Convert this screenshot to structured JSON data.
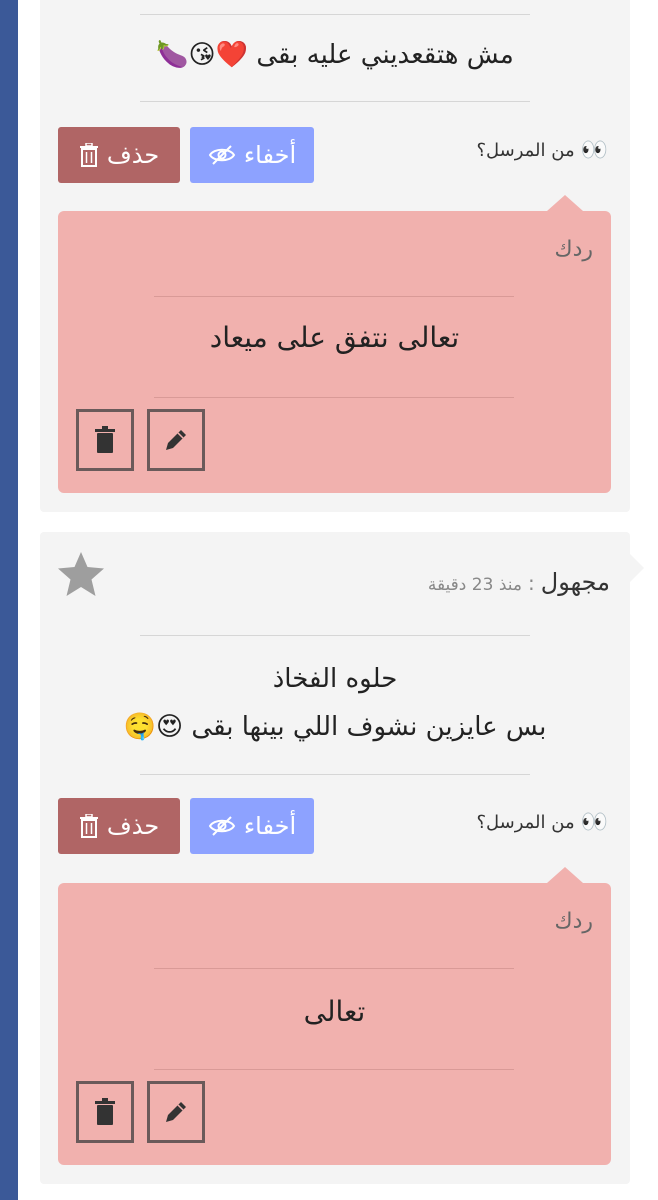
{
  "colors": {
    "sidebar": "#3b5998",
    "card_bg": "#f4f4f4",
    "hide_button": "#8da2ff",
    "delete_button": "#b06565",
    "reply_bg": "#f1b1ae"
  },
  "messages": [
    {
      "text": "مش هتقعديني عليه بقى",
      "emojis": "❤️😘🍆",
      "hide_label": "أخفاء",
      "delete_label": "حذف",
      "from_sender": "من المرسل؟",
      "reply": {
        "label": "ردك",
        "text": "تعالى نتفق على ميعاد"
      }
    },
    {
      "sender": "مجهول",
      "separator": ":",
      "time": "منذ 23 دقيقة",
      "line1": "حلوه الفخاذ",
      "line2": "بس عايزين نشوف اللي بينها بقى",
      "emojis2": "😍🤤",
      "hide_label": "أخفاء",
      "delete_label": "حذف",
      "from_sender": "من المرسل؟",
      "reply": {
        "label": "ردك",
        "text": "تعالى"
      }
    }
  ],
  "icons": {
    "eyes": "👀",
    "trash": "trash-icon",
    "eye_slash": "eye-slash-icon",
    "pencil": "pencil-icon",
    "star": "star-icon"
  }
}
